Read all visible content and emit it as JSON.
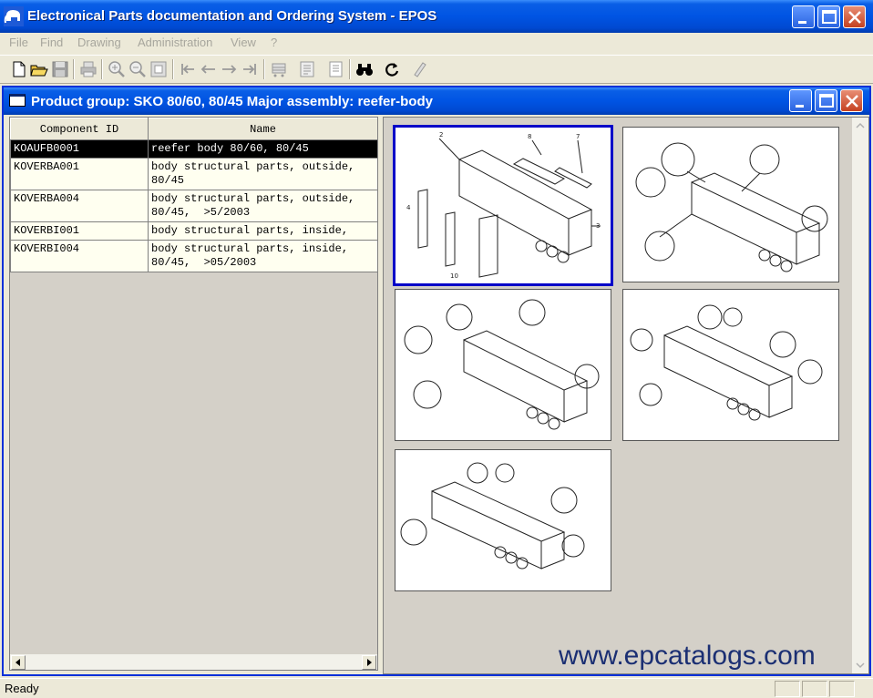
{
  "app": {
    "title": "Electronical Parts documentation and Ordering System - EPOS"
  },
  "menu": [
    "File",
    "Find",
    "Drawing",
    "Administration",
    "View",
    "?"
  ],
  "child": {
    "title": "Product group: SKO 80/60,  80/45  Major assembly: reefer-body"
  },
  "table": {
    "headers": [
      "Component ID",
      "Name"
    ],
    "rows": [
      {
        "id": "KOAUFB0001",
        "name": "reefer body 80/60, 80/45"
      },
      {
        "id": "KOVERBA001",
        "name": "body structural parts, outside,\n80/45"
      },
      {
        "id": "KOVERBA004",
        "name": "body structural parts, outside,\n80/45,  >5/2003"
      },
      {
        "id": "KOVERBI001",
        "name": "body structural parts, inside,"
      },
      {
        "id": "KOVERBI004",
        "name": "body structural parts, inside,\n80/45,  >05/2003"
      }
    ]
  },
  "watermark": "www.epcatalogs.com",
  "status": {
    "text": "Ready"
  },
  "colors": {
    "title_bar": "#0054e3",
    "selection": "#000000",
    "thumb_selected_border": "#0000c8",
    "watermark": "#1b2f73"
  },
  "icons": [
    "new-icon",
    "open-icon",
    "save-icon",
    "print-icon",
    "zoom-in-icon",
    "zoom-out-icon",
    "zoom-fit-icon",
    "first-icon",
    "prev-icon",
    "next-icon",
    "last-icon",
    "cart-icon",
    "list-icon",
    "document-icon",
    "binoculars-icon",
    "refresh-icon",
    "pen-icon"
  ]
}
